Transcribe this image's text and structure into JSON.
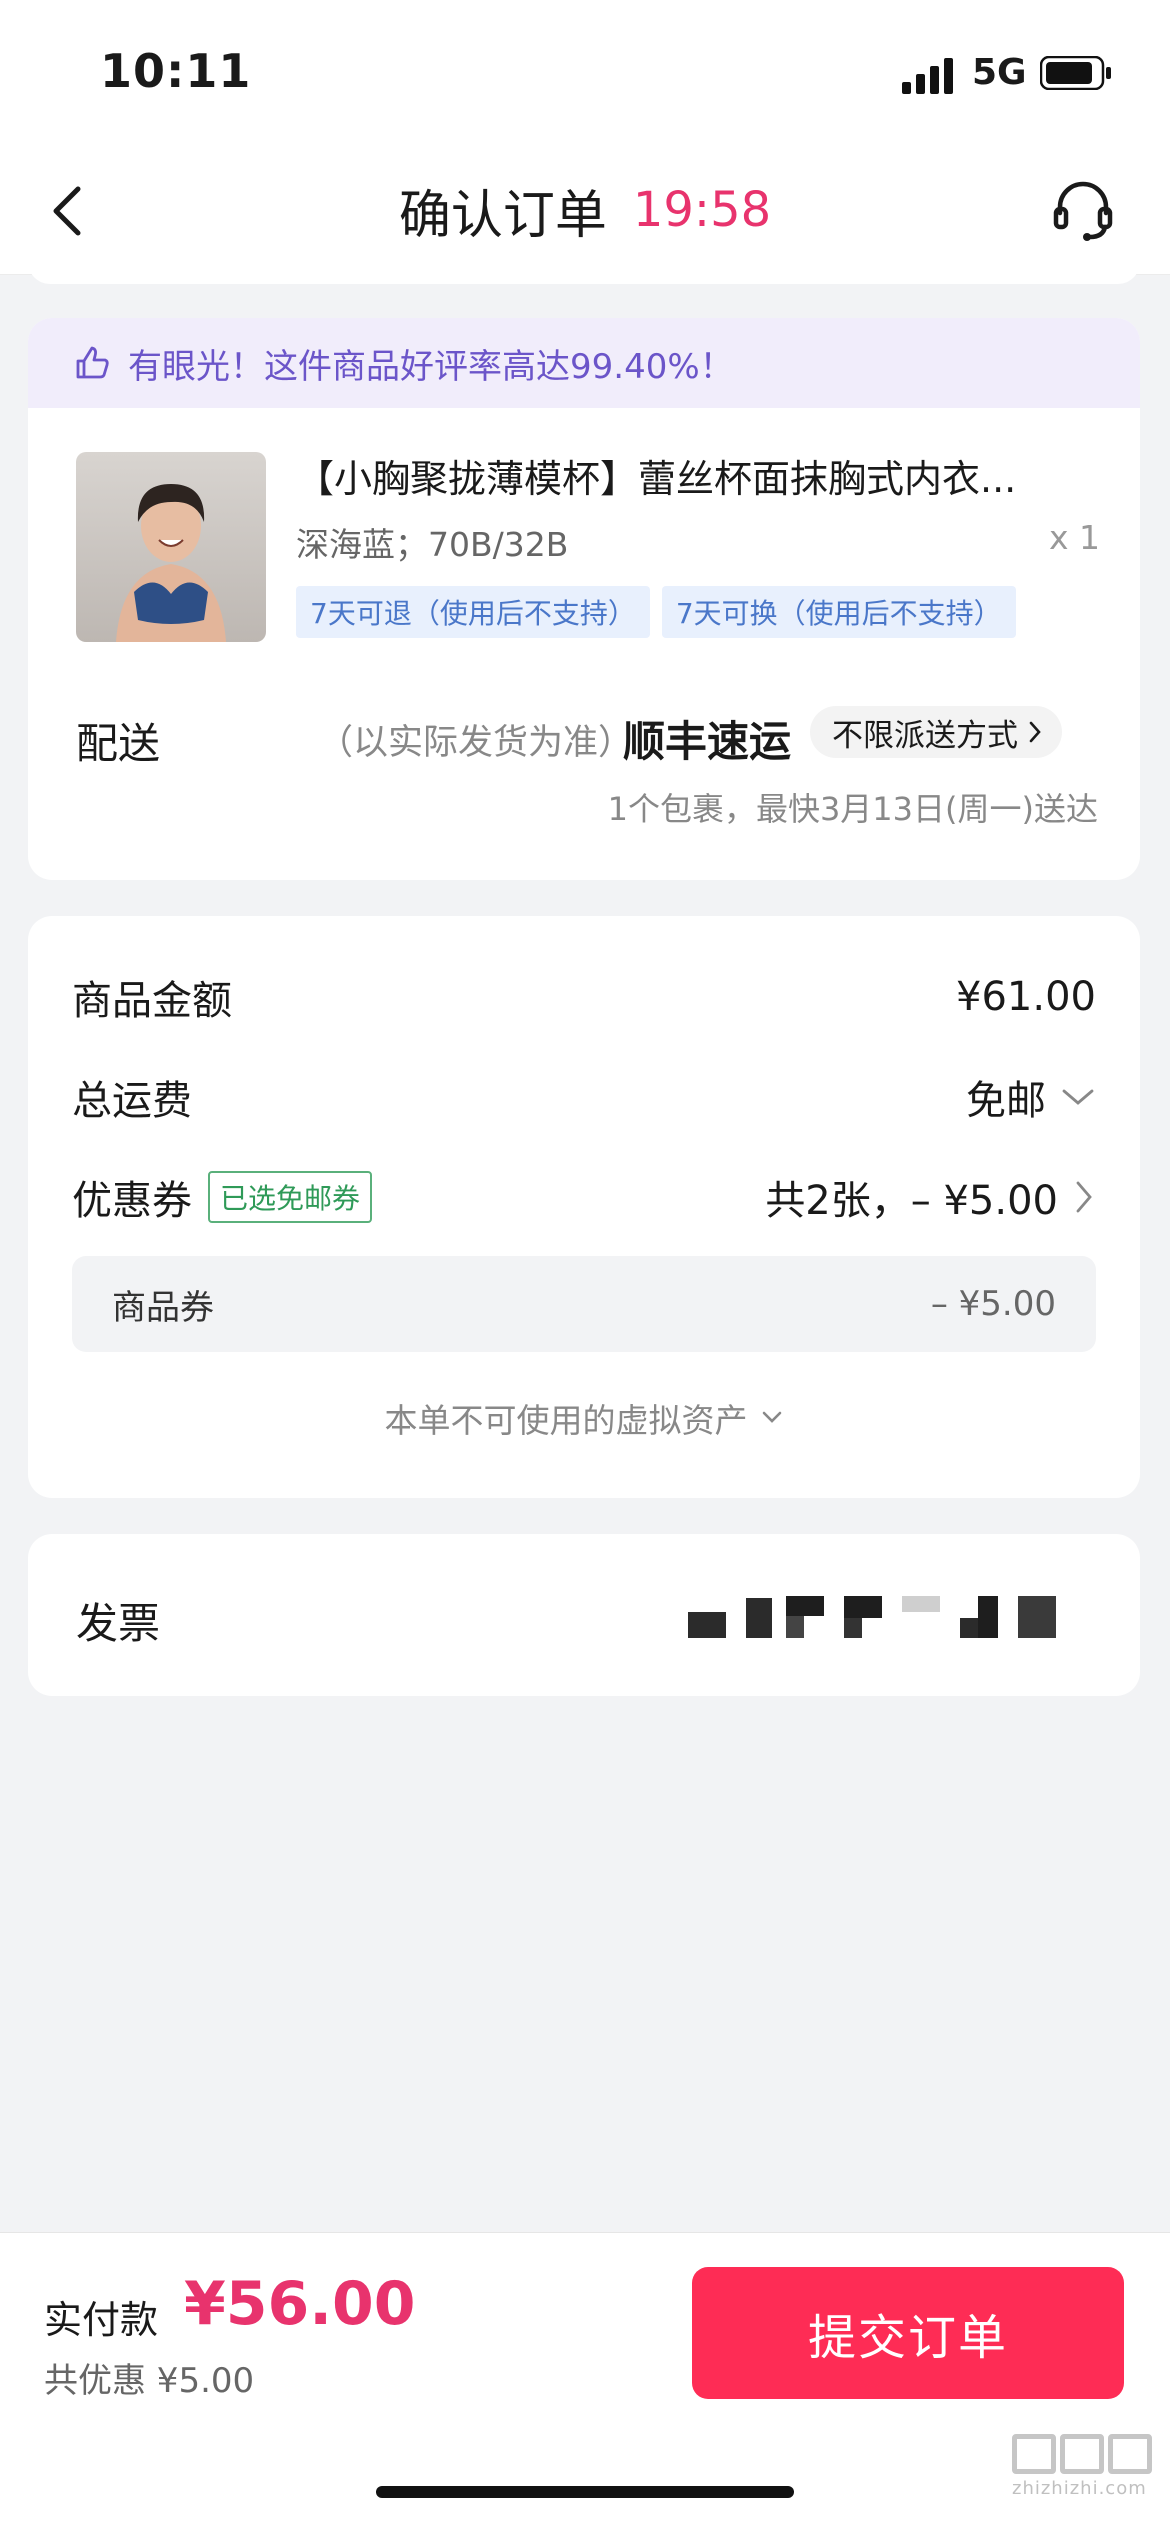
{
  "status": {
    "time": "10:11",
    "network": "5G"
  },
  "nav": {
    "title": "确认订单",
    "timer": "19:58"
  },
  "product_card": {
    "praise": "有眼光！这件商品好评率高达99.40%！",
    "title": "【小胸聚拢薄模杯】蕾丝杯面抹胸式内衣...",
    "spec": "深海蓝；70B/32B",
    "qty": "x 1",
    "tags": [
      "7天可退（使用后不支持）",
      "7天可换（使用后不支持）"
    ],
    "delivery": {
      "label": "配送",
      "note": "（以实际发货为准）",
      "carrier": "顺丰速运",
      "method": "不限派送方式",
      "eta": "1个包裹，最快3月13日(周一)送达"
    }
  },
  "price_card": {
    "goods_label": "商品金额",
    "goods_value": "¥61.00",
    "shipping_label": "总运费",
    "shipping_value": "免邮",
    "coupon_label": "优惠券",
    "coupon_badge": "已选免邮券",
    "coupon_value": "共2张，– ¥5.00",
    "sub_label": "商品券",
    "sub_value": "– ¥5.00",
    "unusable": "本单不可使用的虚拟资产"
  },
  "invoice": {
    "label": "发票"
  },
  "bottom": {
    "pay_label": "实付款",
    "pay_amount": "¥56.00",
    "discount": "共优惠 ¥5.00",
    "submit": "提交订单"
  },
  "watermark": {
    "url": "zhizhizhi.com"
  },
  "colors": {
    "accent": "#fe2c55",
    "timer": "#e8336d",
    "praise": "#6b55c9",
    "badge": "#2f9a58"
  }
}
